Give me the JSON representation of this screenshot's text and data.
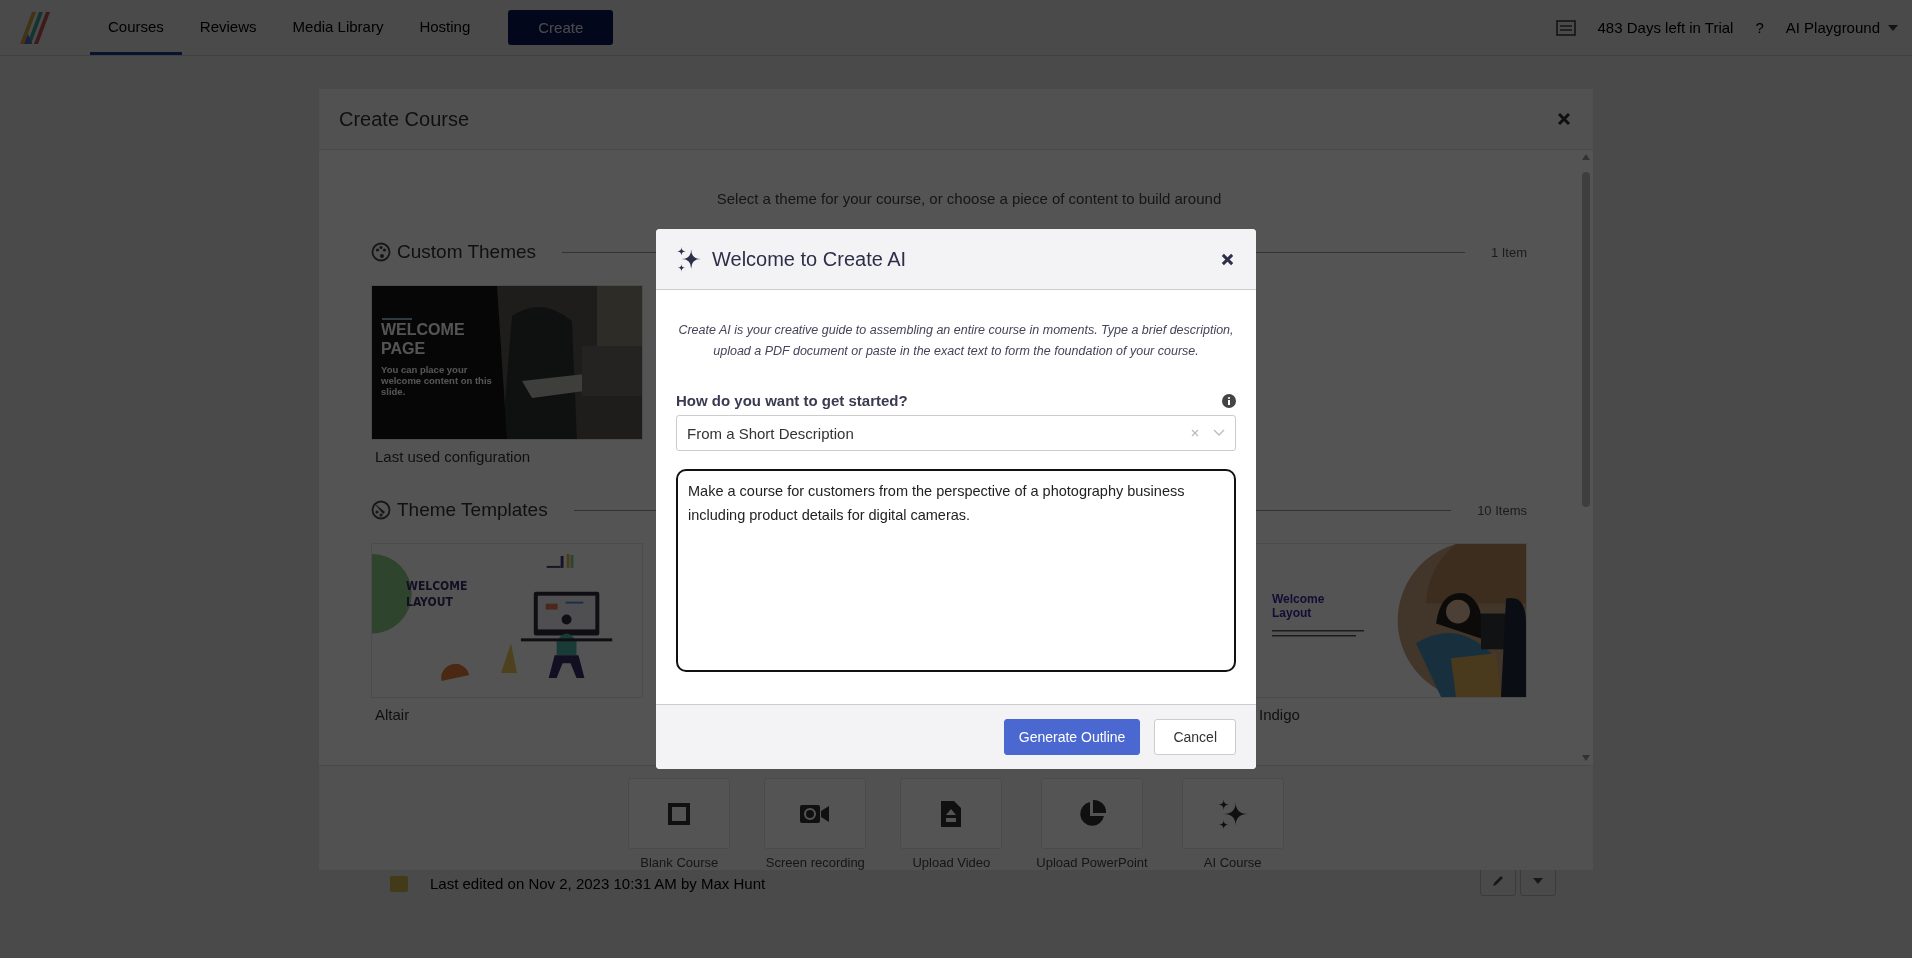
{
  "nav": {
    "tabs": [
      {
        "label": "Courses",
        "selected": true
      },
      {
        "label": "Reviews",
        "selected": false
      },
      {
        "label": "Media Library",
        "selected": false
      },
      {
        "label": "Hosting",
        "selected": false
      }
    ],
    "create_button": "Create",
    "trial": "483 Days left in Trial",
    "help": "?",
    "account": "AI Playground"
  },
  "footer_note": "Last edited on Nov 2, 2023 10:31 AM by Max Hunt",
  "create_course": {
    "title": "Create Course",
    "subtitle": "Select a theme for your course, or choose a piece of content to build around",
    "sections": [
      {
        "title": "Custom Themes",
        "count": "1 Item",
        "cards": [
          {
            "kind": "custom",
            "caption": "Last used configuration",
            "heading": "WELCOME PAGE",
            "body": "You can place your welcome content on this slide."
          }
        ]
      },
      {
        "title": "Theme Templates",
        "count": "10 Items",
        "cards": [
          {
            "kind": "altair",
            "caption": "Altair",
            "heading": "WELCOME LAYOUT"
          },
          {
            "kind": "indigo",
            "caption": "Indigo",
            "heading": "Welcome Layout"
          }
        ]
      }
    ],
    "actions": [
      {
        "label": "Blank Course",
        "kind": "blank"
      },
      {
        "label": "Screen recording",
        "kind": "recording"
      },
      {
        "label": "Upload Video",
        "kind": "video"
      },
      {
        "label": "Upload PowerPoint",
        "kind": "powerpoint"
      },
      {
        "label": "AI Course",
        "kind": "ai"
      }
    ]
  },
  "welcome": {
    "title": "Welcome to Create AI",
    "intro": "Create AI is your creative guide to assembling an entire course in moments. Type a brief description, upload a PDF document or paste in the exact text to form the foundation of your course.",
    "question": "How do you want to get started?",
    "select": {
      "value": "From a Short Description"
    },
    "prompt": {
      "value": "Make a course for customers from the perspective of a photography business including product details for digital cameras."
    },
    "buttons": [
      {
        "label": "Generate Outline",
        "kind": "primary"
      },
      {
        "label": "Cancel",
        "kind": "secondary"
      }
    ]
  }
}
